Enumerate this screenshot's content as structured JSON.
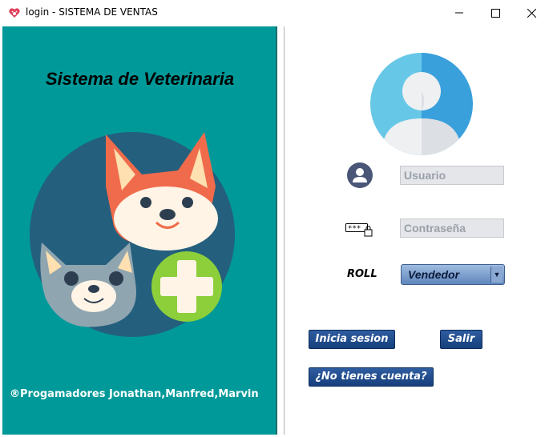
{
  "window": {
    "title": "login - SISTEMA DE VENTAS",
    "icon": "paw-heart-icon",
    "minimize_glyph": "—",
    "maximize_glyph": "☐",
    "close_glyph": "✕"
  },
  "left": {
    "heading": "Sistema de Veterinaria",
    "credits": "®Progamadores Jonathan,Manfred,Marvin",
    "background_color": "#009999"
  },
  "login": {
    "username_placeholder": "Usuario",
    "password_placeholder": "Contraseña",
    "roll_label": "ROLL",
    "roll_selected": "Vendedor",
    "login_button": "Inicia sesion",
    "exit_button": "Salir",
    "register_button": "¿No tienes cuenta?"
  }
}
